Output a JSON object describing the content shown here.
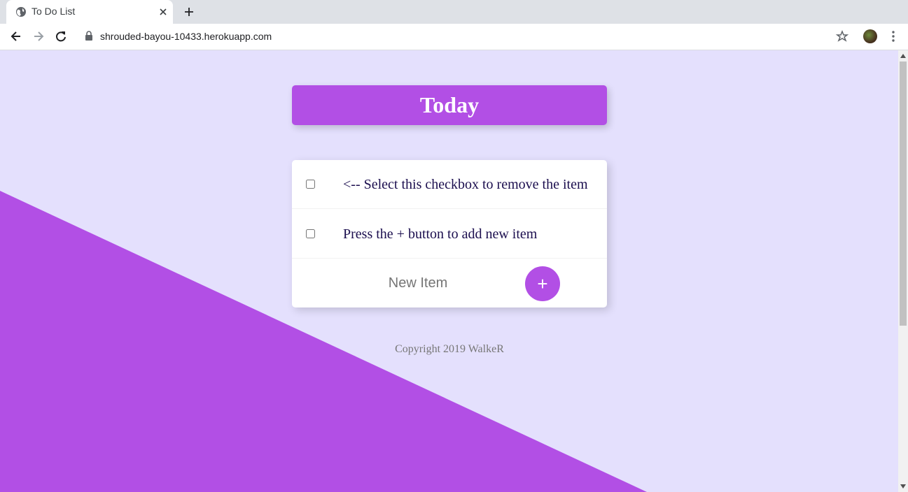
{
  "browser": {
    "tab_title": "To Do List",
    "url": "shrouded-bayou-10433.herokuapp.com",
    "icons": [
      "globe-icon",
      "close-icon",
      "plus-icon",
      "back-icon",
      "forward-icon",
      "reload-icon",
      "lock-icon",
      "star-icon",
      "avatar",
      "kebab-menu-icon"
    ]
  },
  "page": {
    "heading": "Today",
    "items": [
      {
        "text": "<-- Select this checkbox to remove the item",
        "checked": false
      },
      {
        "text": "Press the + button to add new item",
        "checked": false
      }
    ],
    "new_item_placeholder": "New Item",
    "add_button_label": "+",
    "footer": "Copyright 2019 WalkeR"
  },
  "colors": {
    "background": "#e4e0fd",
    "accent": "#b24fe5",
    "item_text": "#1b0e4e",
    "footer_text": "#777777"
  }
}
